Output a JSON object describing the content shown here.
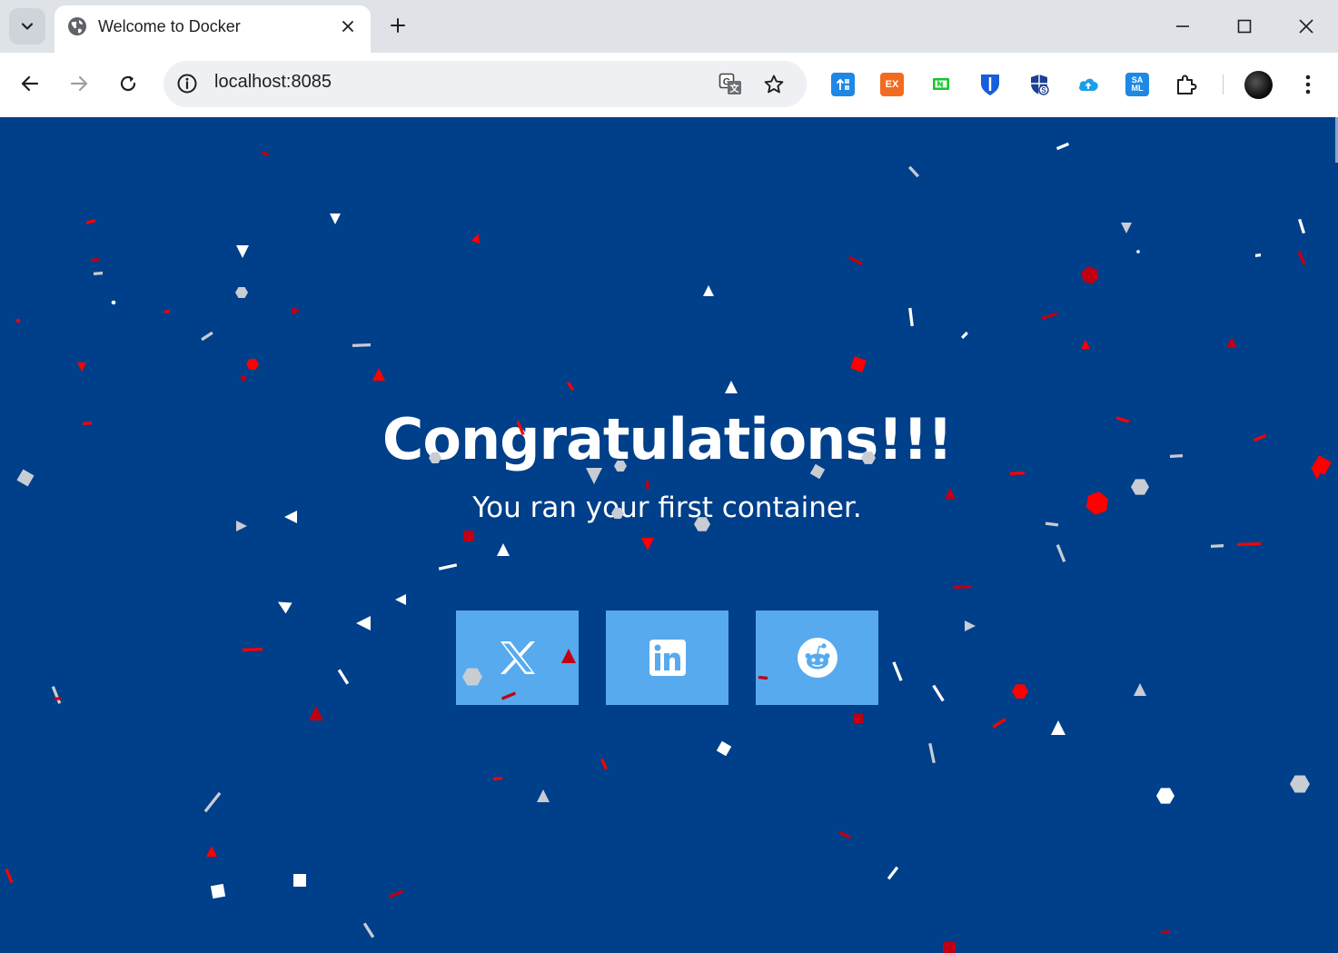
{
  "browser": {
    "tab": {
      "title": "Welcome to Docker",
      "favicon": "globe-icon"
    },
    "address_bar": {
      "url": "localhost:8085"
    },
    "extensions": [
      {
        "name": "azure-extension-icon",
        "label": "",
        "color": "#1e88e5"
      },
      {
        "name": "ex-extension-icon",
        "label": "EX",
        "color": "#f26b21"
      },
      {
        "name": "green-extension-icon",
        "label": "",
        "color": "#19c42d"
      },
      {
        "name": "bitwarden-extension-icon",
        "label": "",
        "color": "#175ddc"
      },
      {
        "name": "shield-extension-icon",
        "label": "",
        "color": "#1c3f94"
      },
      {
        "name": "cloud-extension-icon",
        "label": "",
        "color": "#1aa0e8"
      },
      {
        "name": "saml-extension-icon",
        "label": "SA ML",
        "color": "#1e88e5"
      }
    ]
  },
  "page": {
    "headline": "Congratulations!!!",
    "subline": "You ran your first container.",
    "background": "#003f8a",
    "share_button_color": "#57aaee",
    "share_buttons": [
      {
        "name": "x-share-button",
        "icon": "x-logo-icon"
      },
      {
        "name": "linkedin-share-button",
        "icon": "linkedin-logo-icon"
      },
      {
        "name": "reddit-share-button",
        "icon": "reddit-logo-icon"
      }
    ],
    "confetti_colors": [
      "#ff0000",
      "#c00012",
      "#ffffff",
      "#c8ccd3"
    ]
  }
}
